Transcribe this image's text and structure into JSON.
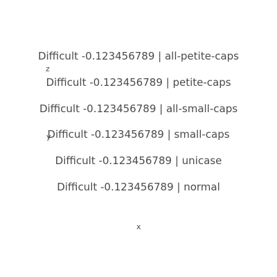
{
  "samples": [
    {
      "text": "Difficult -0.123456789 | all-petite-caps"
    },
    {
      "text": "Difficult -0.123456789 | petite-caps"
    },
    {
      "text": "Difficult -0.123456789 | all-small-caps"
    },
    {
      "text": "Difficult -0.123456789 | small-caps"
    },
    {
      "text": "Difficult -0.123456789 | unicase"
    },
    {
      "text": "Difficult -0.123456789 | normal"
    }
  ],
  "axes": {
    "z_label": "z",
    "y_label": "y",
    "x_label": "x"
  }
}
